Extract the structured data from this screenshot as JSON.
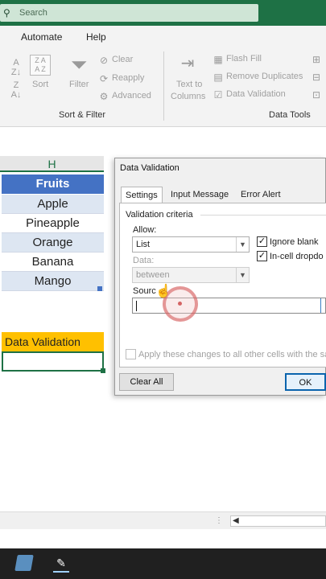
{
  "search": {
    "label": "Search"
  },
  "menu": {
    "items": [
      "Automate",
      "Help"
    ]
  },
  "ribbon": {
    "sort_filter": {
      "sort": "Sort",
      "filter": "Filter",
      "clear": "Clear",
      "reapply": "Reapply",
      "advanced": "Advanced",
      "group_label": "Sort & Filter"
    },
    "data_tools": {
      "text_to_columns_1": "Text to",
      "text_to_columns_2": "Columns",
      "flash_fill": "Flash Fill",
      "remove_duplicates": "Remove Duplicates",
      "data_validation": "Data Validation",
      "group_label": "Data Tools"
    }
  },
  "sheet": {
    "column_letter": "H",
    "header": "Fruits",
    "fruits": [
      "Apple",
      "Pineapple",
      "Orange",
      "Banana",
      "Mango"
    ],
    "dv_label": "Data Validation"
  },
  "dialog": {
    "title": "Data Validation",
    "tabs": [
      "Settings",
      "Input Message",
      "Error Alert"
    ],
    "section": "Validation criteria",
    "allow_label": "Allow:",
    "allow_value": "List",
    "data_label": "Data:",
    "data_value": "between",
    "ignore_blank": "Ignore blank",
    "in_cell_dropdown": "In-cell dropdo",
    "source_label": "Sourc",
    "apply_all": "Apply these changes to all other cells with the sa",
    "clear_all": "Clear All",
    "ok": "OK"
  },
  "colors": {
    "excel_green": "#1e7145",
    "header_blue": "#4472c4",
    "band_blue": "#dde6f2",
    "dv_yellow": "#ffc000"
  }
}
